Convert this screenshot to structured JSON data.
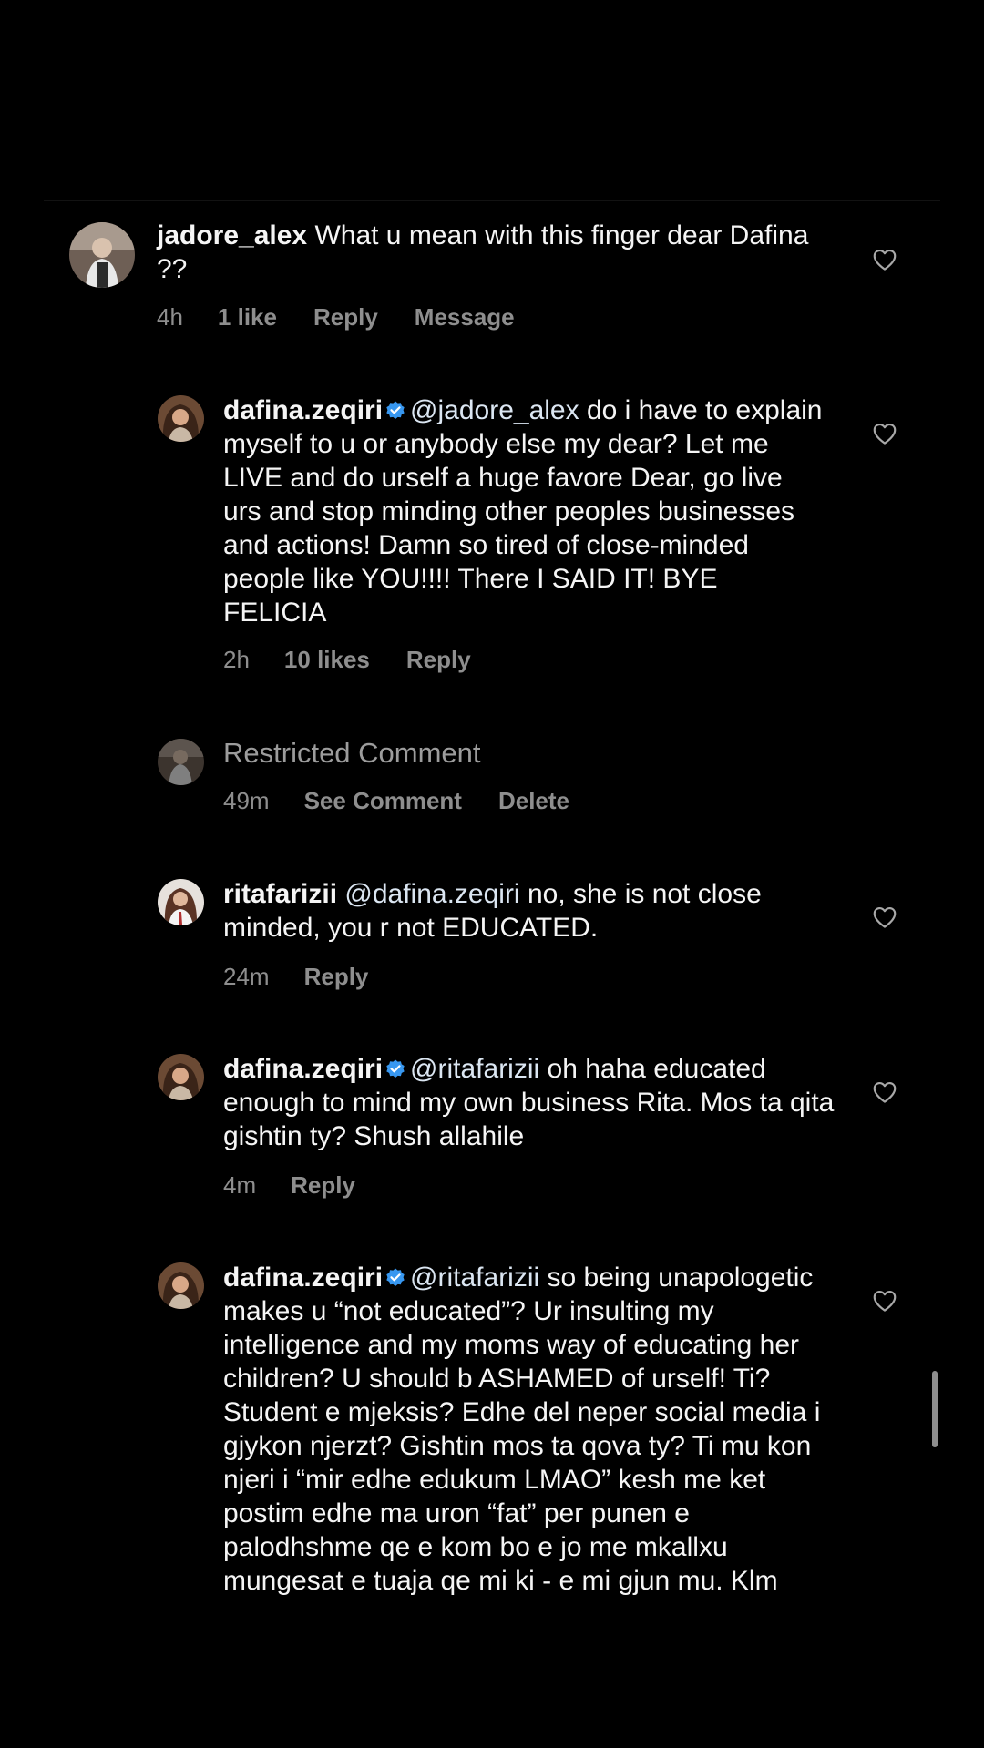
{
  "comments": [
    {
      "username": "jadore_alex",
      "text": " What u mean with this finger dear Dafina ??",
      "time": "4h",
      "likes": "1 like",
      "reply": "Reply",
      "message": "Message"
    },
    {
      "username": "dafina.zeqiri",
      "mention": "@jadore_alex",
      "text": " do i have to explain myself to u or anybody else my dear? Let me LIVE and do urself a huge favore Dear, go live urs and stop minding other peoples businesses and actions! Damn so tired of close-minded people like YOU!!!! There I SAID IT! BYE FELICIA",
      "time": "2h",
      "likes": "10 likes",
      "reply": "Reply"
    },
    {
      "restricted_label": "Restricted Comment",
      "time": "49m",
      "see_comment": "See Comment",
      "delete": "Delete"
    },
    {
      "username": "ritafarizii",
      "mention": " @dafina.zeqiri",
      "text": " no, she is not close minded, you r not EDUCATED.",
      "time": "24m",
      "reply": "Reply"
    },
    {
      "username": "dafina.zeqiri",
      "mention": "@ritafarizii",
      "text": " oh haha educated enough to mind my own business Rita. Mos ta qita gishtin ty? Shush allahile",
      "time": "4m",
      "reply": "Reply"
    },
    {
      "username": "dafina.zeqiri",
      "mention": "@ritafarizii",
      "text": " so being unapologetic makes u “not educated”? Ur insulting my intelligence and my moms way of educating her children? U should b ASHAMED of urself! Ti? Student e mjeksis? Edhe del neper social media i gjykon njerzt? Gishtin mos ta qova ty? Ti mu kon njeri i “mir edhe edukum LMAO” kesh me ket postim edhe ma uron “fat” per punen e palodhshme qe e kom bo e jo me mkallxu mungesat e tuaja qe mi ki - e mi gjun mu. Klm"
    }
  ],
  "icons": {
    "like": "heart-outline-icon",
    "verified": "verified-badge-icon"
  },
  "colors": {
    "background": "#000000",
    "text": "#f5f5f5",
    "secondary": "#8e8e8e",
    "verified": "#3797f0"
  }
}
